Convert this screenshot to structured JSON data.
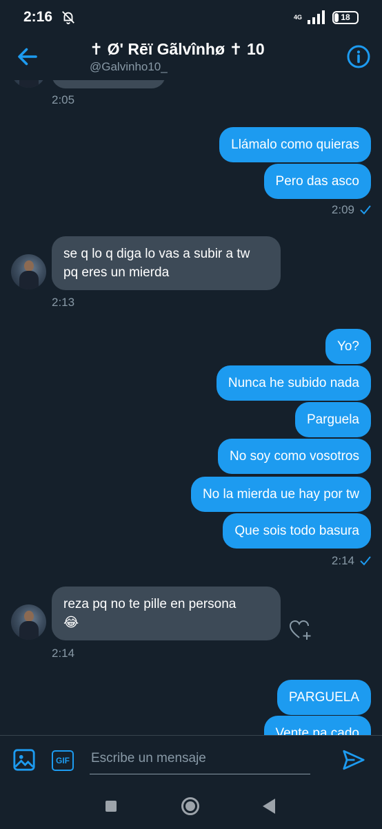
{
  "status_bar": {
    "time": "2:16",
    "network": "4G",
    "battery": "18"
  },
  "header": {
    "title": "✝ Ø' Rēï Gãlvînhø ✝ 10",
    "handle": "@Galvinho10_"
  },
  "messages": {
    "time_0": "2:05",
    "out_1": "Llámalo como quieras",
    "out_2": "Pero das asco",
    "time_1": "2:09",
    "in_1_line1": "se q lo q diga lo vas a subir a tw",
    "in_1_line2": "pq eres un mierda",
    "time_2": "2:13",
    "out_3": "Yo?",
    "out_4": "Nunca he subido nada",
    "out_5": "Parguela",
    "out_6": "No soy como vosotros",
    "out_7": "No la mierda ue hay por tw",
    "out_8": "Que sois todo basura",
    "time_3": "2:14",
    "in_2_line1": "reza pq no te pille en persona",
    "in_2_line2": "😂",
    "time_4": "2:14",
    "out_9": "PARGUELA",
    "out_10": "Vente pa cado"
  },
  "composer": {
    "gif_label": "GIF",
    "placeholder": "Escribe un mensaje"
  },
  "colors": {
    "background": "#15202b",
    "accent": "#1d9bf0",
    "incoming_bubble": "#3d4a57",
    "muted_text": "#8899a6"
  },
  "icons": [
    "back-arrow-icon",
    "info-icon",
    "image-icon",
    "gif-icon",
    "send-icon",
    "heart-plus-icon",
    "check-icon",
    "mute-bell-icon",
    "signal-icon",
    "battery-icon"
  ]
}
